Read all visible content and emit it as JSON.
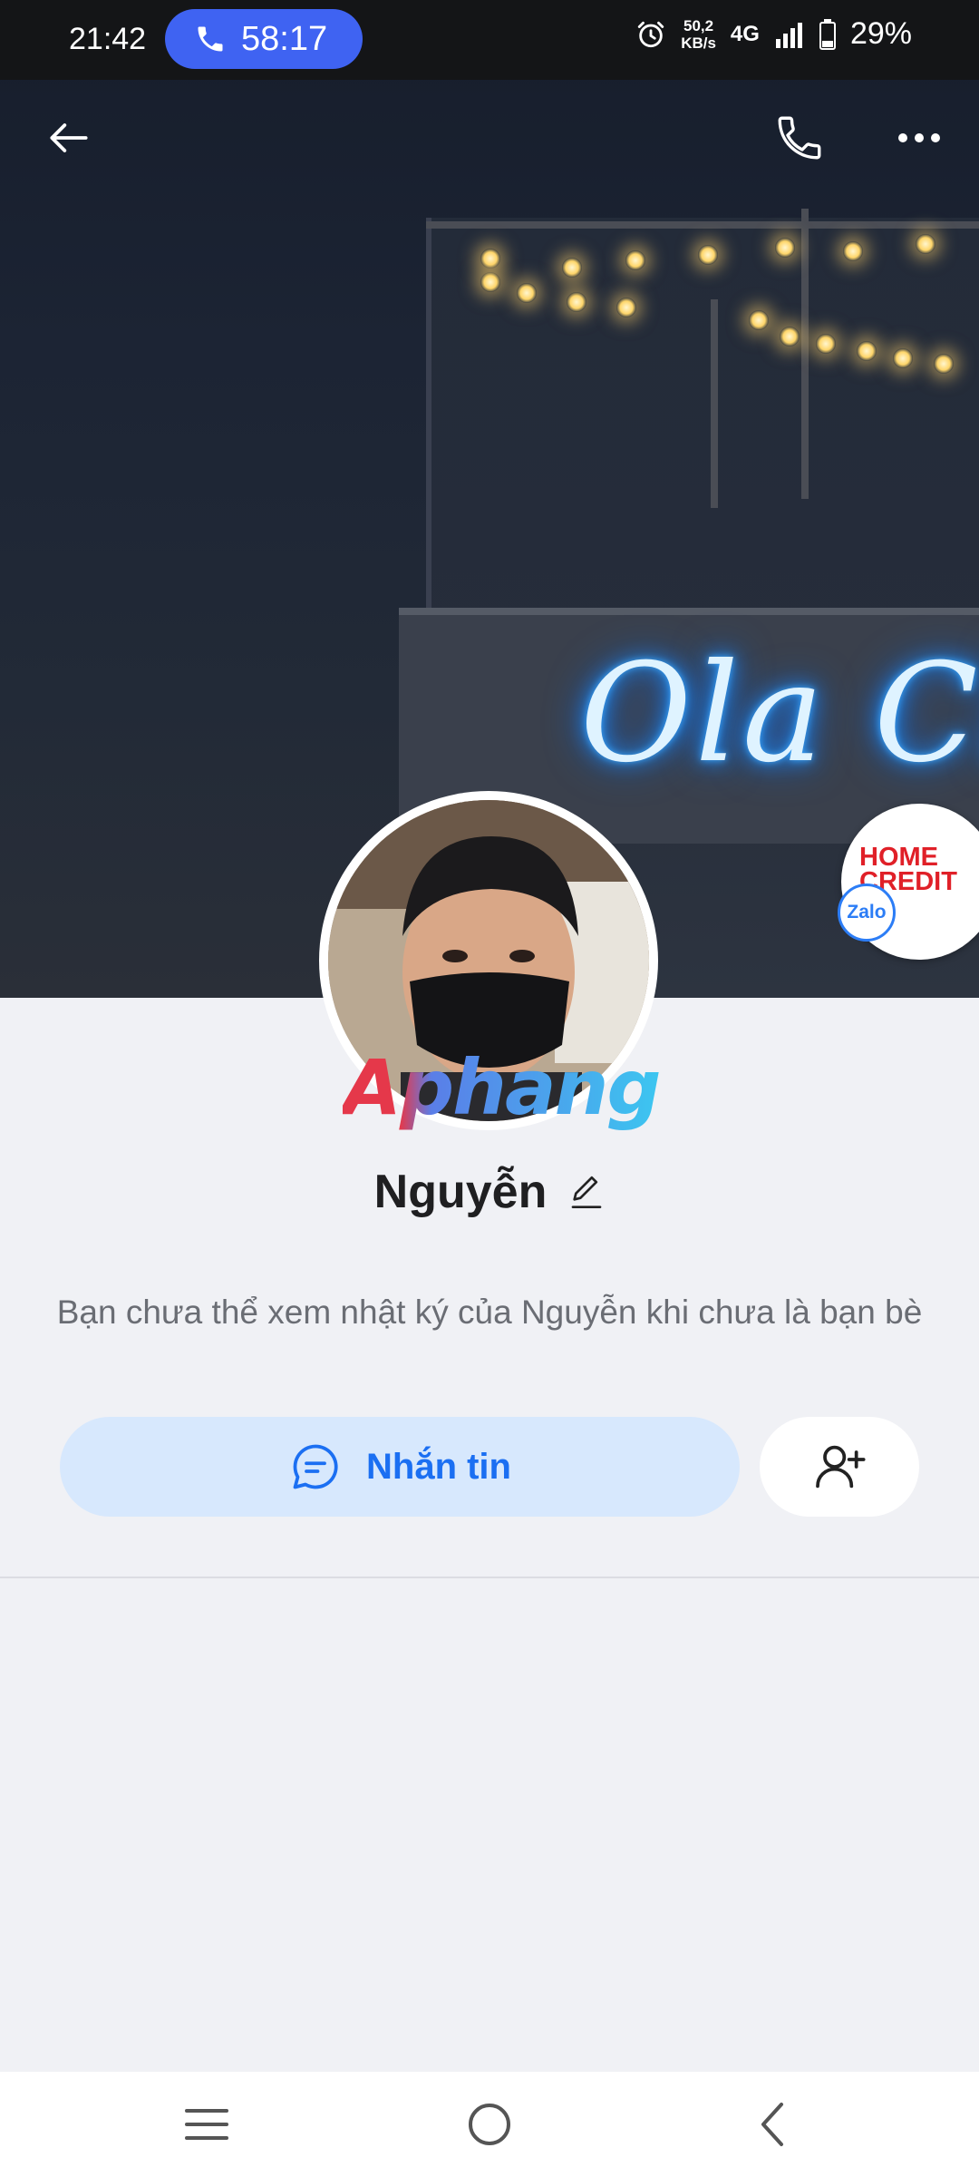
{
  "status_bar": {
    "time": "21:42",
    "call_duration": "58:17",
    "net_speed_value": "50,2",
    "net_speed_unit": "KB/s",
    "network_type": "4G",
    "battery": "29%"
  },
  "cover": {
    "neon_text": "Ola Ch"
  },
  "avatar": {
    "watermark": "Aphang"
  },
  "sticker": {
    "brand_text": "HOME CREDIT",
    "badge": "Zalo"
  },
  "profile": {
    "name": "Nguyễn",
    "notice": "Bạn chưa thể xem nhật ký của Nguyễn khi chưa là bạn bè"
  },
  "actions": {
    "message_label": "Nhắn tin"
  },
  "colors": {
    "accent": "#1b6ff2",
    "message_button_bg": "#d7e8fd",
    "call_pill": "#3f63f2",
    "page_bg": "#f0f1f5"
  }
}
